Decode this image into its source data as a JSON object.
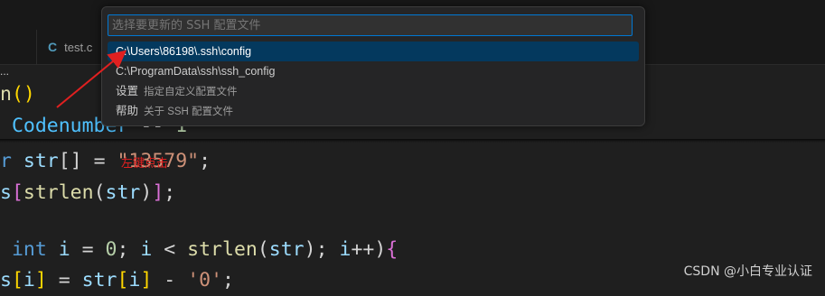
{
  "tabs": [
    {
      "icon": "c-file-icon",
      "icon_glyph": "C",
      "label": "test.c"
    }
  ],
  "breadcrumb_dots": "...",
  "code_lines": [
    {
      "t": [
        {
          "c": "tok-fn",
          "s": "n"
        },
        {
          "c": "tok-paren",
          "s": "()"
        }
      ]
    },
    {
      "t": [
        {
          "c": "tok-macro",
          "s": " Codenumber"
        },
        {
          "c": "tok-plain",
          "s": " -- "
        },
        {
          "c": "tok-num",
          "s": "1"
        }
      ]
    },
    {
      "t": [
        {
          "c": "tok-kw",
          "s": "r"
        },
        {
          "c": "tok-plain",
          "s": " "
        },
        {
          "c": "tok-var",
          "s": "str"
        },
        {
          "c": "tok-plain",
          "s": "[] = "
        },
        {
          "c": "tok-str",
          "s": "\"13579\""
        },
        {
          "c": "tok-plain",
          "s": ";"
        }
      ]
    },
    {
      "t": [
        {
          "c": "tok-var",
          "s": "s"
        },
        {
          "c": "tok-paren2",
          "s": "["
        },
        {
          "c": "tok-fn",
          "s": "strlen"
        },
        {
          "c": "tok-plain",
          "s": "("
        },
        {
          "c": "tok-var",
          "s": "str"
        },
        {
          "c": "tok-plain",
          "s": ")"
        },
        {
          "c": "tok-paren2",
          "s": "]"
        },
        {
          "c": "tok-plain",
          "s": ";"
        }
      ]
    },
    {
      "t": []
    },
    {
      "t": [
        {
          "c": "tok-kw",
          "s": " int"
        },
        {
          "c": "tok-plain",
          "s": " "
        },
        {
          "c": "tok-var",
          "s": "i"
        },
        {
          "c": "tok-plain",
          "s": " = "
        },
        {
          "c": "tok-num",
          "s": "0"
        },
        {
          "c": "tok-plain",
          "s": "; "
        },
        {
          "c": "tok-var",
          "s": "i"
        },
        {
          "c": "tok-plain",
          "s": " < "
        },
        {
          "c": "tok-fn",
          "s": "strlen"
        },
        {
          "c": "tok-plain",
          "s": "("
        },
        {
          "c": "tok-var",
          "s": "str"
        },
        {
          "c": "tok-plain",
          "s": "); "
        },
        {
          "c": "tok-var",
          "s": "i"
        },
        {
          "c": "tok-plain",
          "s": "++)"
        },
        {
          "c": "tok-paren2",
          "s": "{"
        }
      ]
    },
    {
      "t": [
        {
          "c": "tok-var",
          "s": "s"
        },
        {
          "c": "tok-paren",
          "s": "["
        },
        {
          "c": "tok-var",
          "s": "i"
        },
        {
          "c": "tok-paren",
          "s": "]"
        },
        {
          "c": "tok-plain",
          "s": " = "
        },
        {
          "c": "tok-var",
          "s": "str"
        },
        {
          "c": "tok-paren",
          "s": "["
        },
        {
          "c": "tok-var",
          "s": "i"
        },
        {
          "c": "tok-paren",
          "s": "]"
        },
        {
          "c": "tok-plain",
          "s": " - "
        },
        {
          "c": "tok-str",
          "s": "'0'"
        },
        {
          "c": "tok-plain",
          "s": ";"
        }
      ]
    }
  ],
  "quickpick": {
    "placeholder": "选择要更新的 SSH 配置文件",
    "items": [
      {
        "label": "C:\\Users\\86198\\.ssh\\config",
        "desc": "",
        "selected": true
      },
      {
        "label": "C:\\ProgramData\\ssh\\ssh_config",
        "desc": "",
        "selected": false
      },
      {
        "label": "设置",
        "desc": "指定自定义配置文件",
        "selected": false
      },
      {
        "label": "帮助",
        "desc": "关于 SSH 配置文件",
        "selected": false
      }
    ]
  },
  "annotation": {
    "text": "左键点击",
    "color": "#e02020"
  },
  "watermark": "CSDN @小白专业认证",
  "colors": {
    "accent": "#0078d4",
    "selection": "#04395e",
    "editor_bg": "#1f1f1f"
  }
}
